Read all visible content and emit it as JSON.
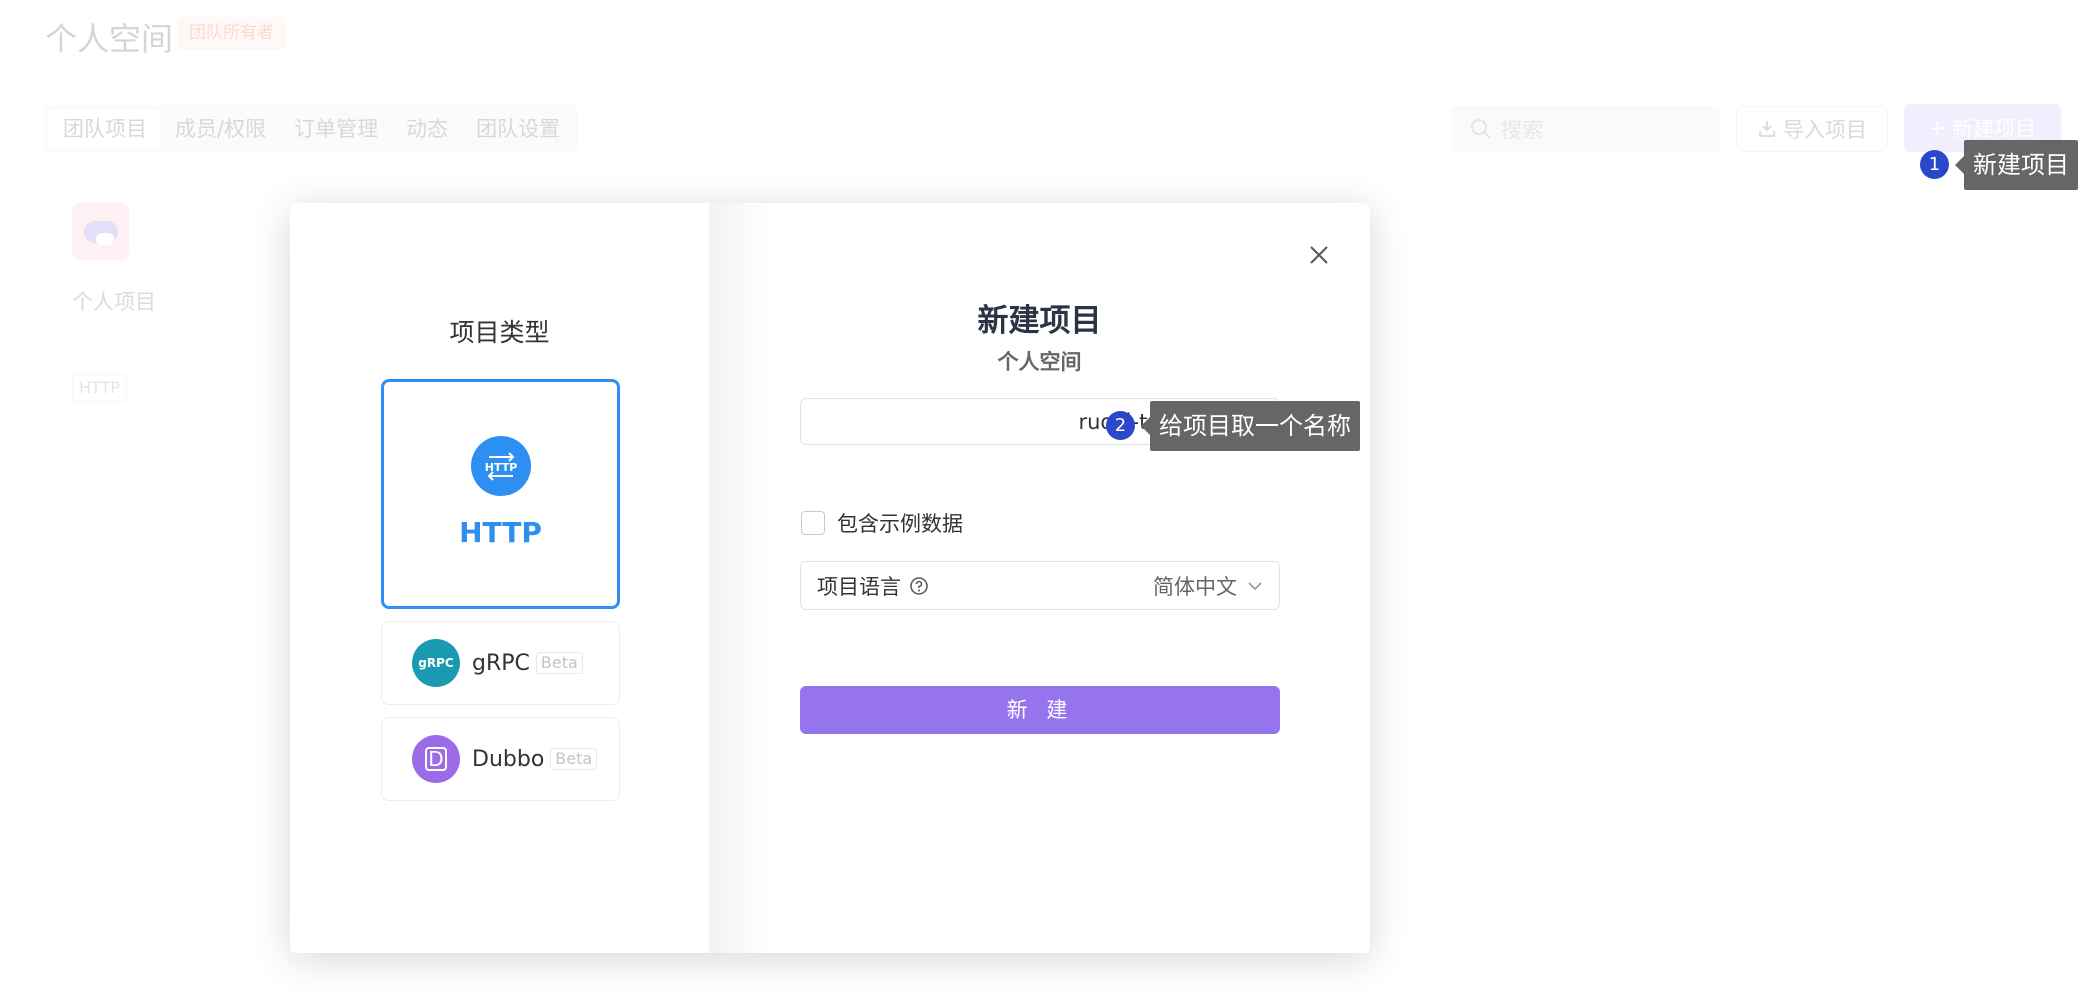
{
  "background": {
    "title": "个人空间",
    "badge": "团队所有者",
    "tabs": [
      "团队项目",
      "成员/权限",
      "订单管理",
      "动态",
      "团队设置"
    ],
    "search_placeholder": "搜索",
    "import_label": "导入项目",
    "new_label": "新建项目",
    "card": {
      "name": "个人项目",
      "tag": "HTTP"
    }
  },
  "tour": {
    "step1_number": "1",
    "step1_text": "新建项目",
    "step2_number": "2",
    "step2_text": "给项目取一个名称"
  },
  "modal": {
    "type_title": "项目类型",
    "types": [
      {
        "label": "HTTP",
        "icon_text": "HTTP",
        "selected": true
      },
      {
        "label": "gRPC",
        "icon_text": "gRPC",
        "beta": "Beta"
      },
      {
        "label": "Dubbo",
        "icon_text": "D",
        "beta": "Beta"
      }
    ],
    "title": "新建项目",
    "subtitle": "个人空间",
    "name_value": "ruoyi-tdesign",
    "include_sample_label": "包含示例数据",
    "lang_label": "项目语言",
    "lang_value": "简体中文",
    "create_label": "新 建"
  },
  "colors": {
    "accent_purple": "#9574ee",
    "http_blue": "#2e8ff2",
    "grpc_teal": "#1a9ab0",
    "dubbo_purple": "#9b6be8",
    "tour_dot": "#2a48c8"
  }
}
